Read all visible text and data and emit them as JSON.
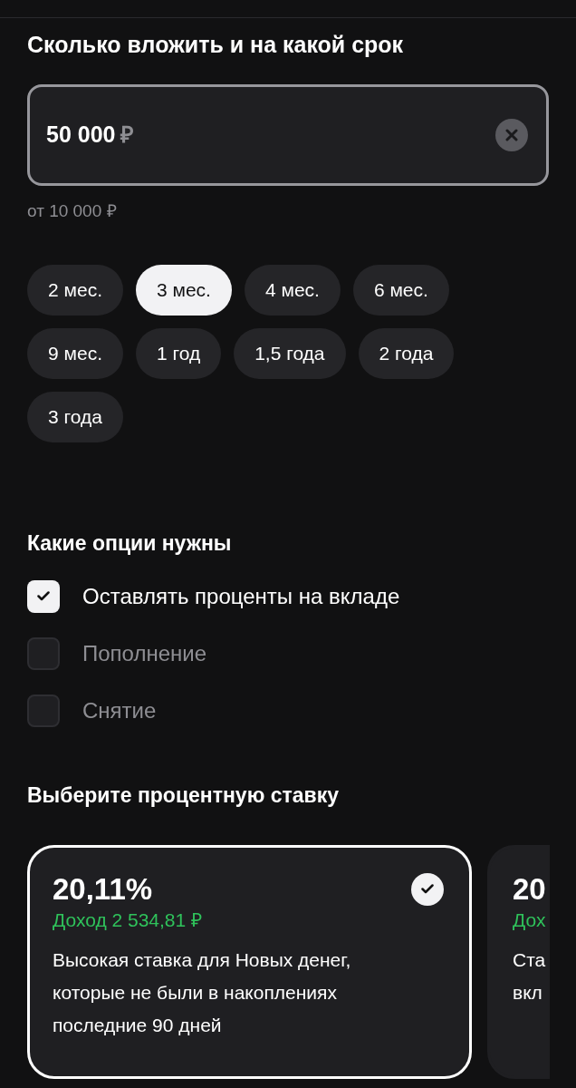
{
  "amount_section": {
    "heading": "Сколько вложить и на какой срок",
    "amount_field": {
      "value": "50 000",
      "currency": "₽"
    },
    "hint": "от 10 000 ₽"
  },
  "terms": [
    {
      "label": "2 мес.",
      "selected": false
    },
    {
      "label": "3 мес.",
      "selected": true
    },
    {
      "label": "4 мес.",
      "selected": false
    },
    {
      "label": "6 мес.",
      "selected": false
    },
    {
      "label": "9 мес.",
      "selected": false
    },
    {
      "label": "1 год",
      "selected": false
    },
    {
      "label": "1,5 года",
      "selected": false
    },
    {
      "label": "2 года",
      "selected": false
    },
    {
      "label": "3 года",
      "selected": false
    }
  ],
  "options_section": {
    "heading": "Какие опции нужны",
    "options": [
      {
        "label": "Оставлять проценты на вкладе",
        "checked": true
      },
      {
        "label": "Пополнение",
        "checked": false
      },
      {
        "label": "Снятие",
        "checked": false
      }
    ]
  },
  "rates_section": {
    "heading": "Выберите процентную ставку",
    "cards": [
      {
        "rate": "20,11%",
        "income": "Доход 2 534,81 ₽",
        "description_lines": [
          "Высокая ставка для Новых денег,",
          "которые не были в накоплениях",
          "последние 90 дней"
        ],
        "selected": true
      },
      {
        "rate": "20",
        "income": "Дох",
        "description_lines": [
          "Ста",
          "вкл"
        ],
        "selected": false
      }
    ]
  }
}
